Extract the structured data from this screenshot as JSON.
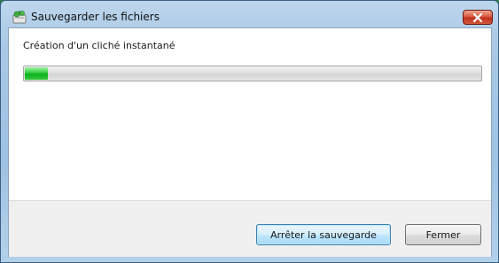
{
  "window": {
    "title": "Sauvegarder les fichiers",
    "icon": "backup-app-icon",
    "close_icon": "close-icon"
  },
  "main": {
    "status_text": "Création d'un cliché instantané",
    "progress_fraction": 0.05
  },
  "buttons": {
    "stop_label": "Arrêter la sauvegarde",
    "close_label": "Fermer"
  },
  "colors": {
    "progress_green": "#14b423",
    "close_red": "#c8391f",
    "default_button_border": "#3c7fb1"
  }
}
